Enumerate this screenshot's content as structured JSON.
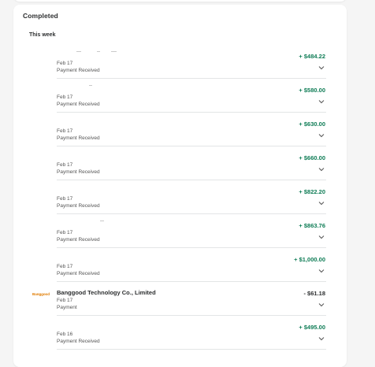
{
  "section": {
    "title": "Completed",
    "group_title": "This week"
  },
  "transactions": [
    {
      "merchant": "",
      "date": "Feb 17",
      "status": "Payment Received",
      "amount": "+ $484.22",
      "direction": "in"
    },
    {
      "merchant": "",
      "date": "Feb 17",
      "status": "Payment Received",
      "amount": "+ $580.00",
      "direction": "in"
    },
    {
      "merchant": "",
      "date": "Feb 17",
      "status": "Payment Received",
      "amount": "+ $630.00",
      "direction": "in"
    },
    {
      "merchant": "",
      "date": "Feb 17",
      "status": "Payment Received",
      "amount": "+ $660.00",
      "direction": "in"
    },
    {
      "merchant": "",
      "date": "Feb 17",
      "status": "Payment Received",
      "amount": "+ $822.20",
      "direction": "in"
    },
    {
      "merchant": "",
      "date": "Feb 17",
      "status": "Payment Received",
      "amount": "+ $863.76",
      "direction": "in"
    },
    {
      "merchant": "",
      "date": "Feb 17",
      "status": "Payment Received",
      "amount": "+ $1,000.00",
      "direction": "in"
    },
    {
      "merchant": "Banggood Technology Co., Limited",
      "logo_text": "Banggood",
      "date": "Feb 17",
      "status": "Payment",
      "amount": "- $61.18",
      "direction": "out"
    },
    {
      "merchant": "",
      "date": "Feb 16",
      "status": "Payment Received",
      "amount": "+ $495.00",
      "direction": "in"
    }
  ],
  "icons": {
    "expand": "chevron-down-icon",
    "merchant_logo": "banggood-logo"
  },
  "colors": {
    "positive_amount": "#0e7c55",
    "negative_amount": "#2c2e2f",
    "background": "#f5f5f5",
    "card": "#ffffff"
  }
}
